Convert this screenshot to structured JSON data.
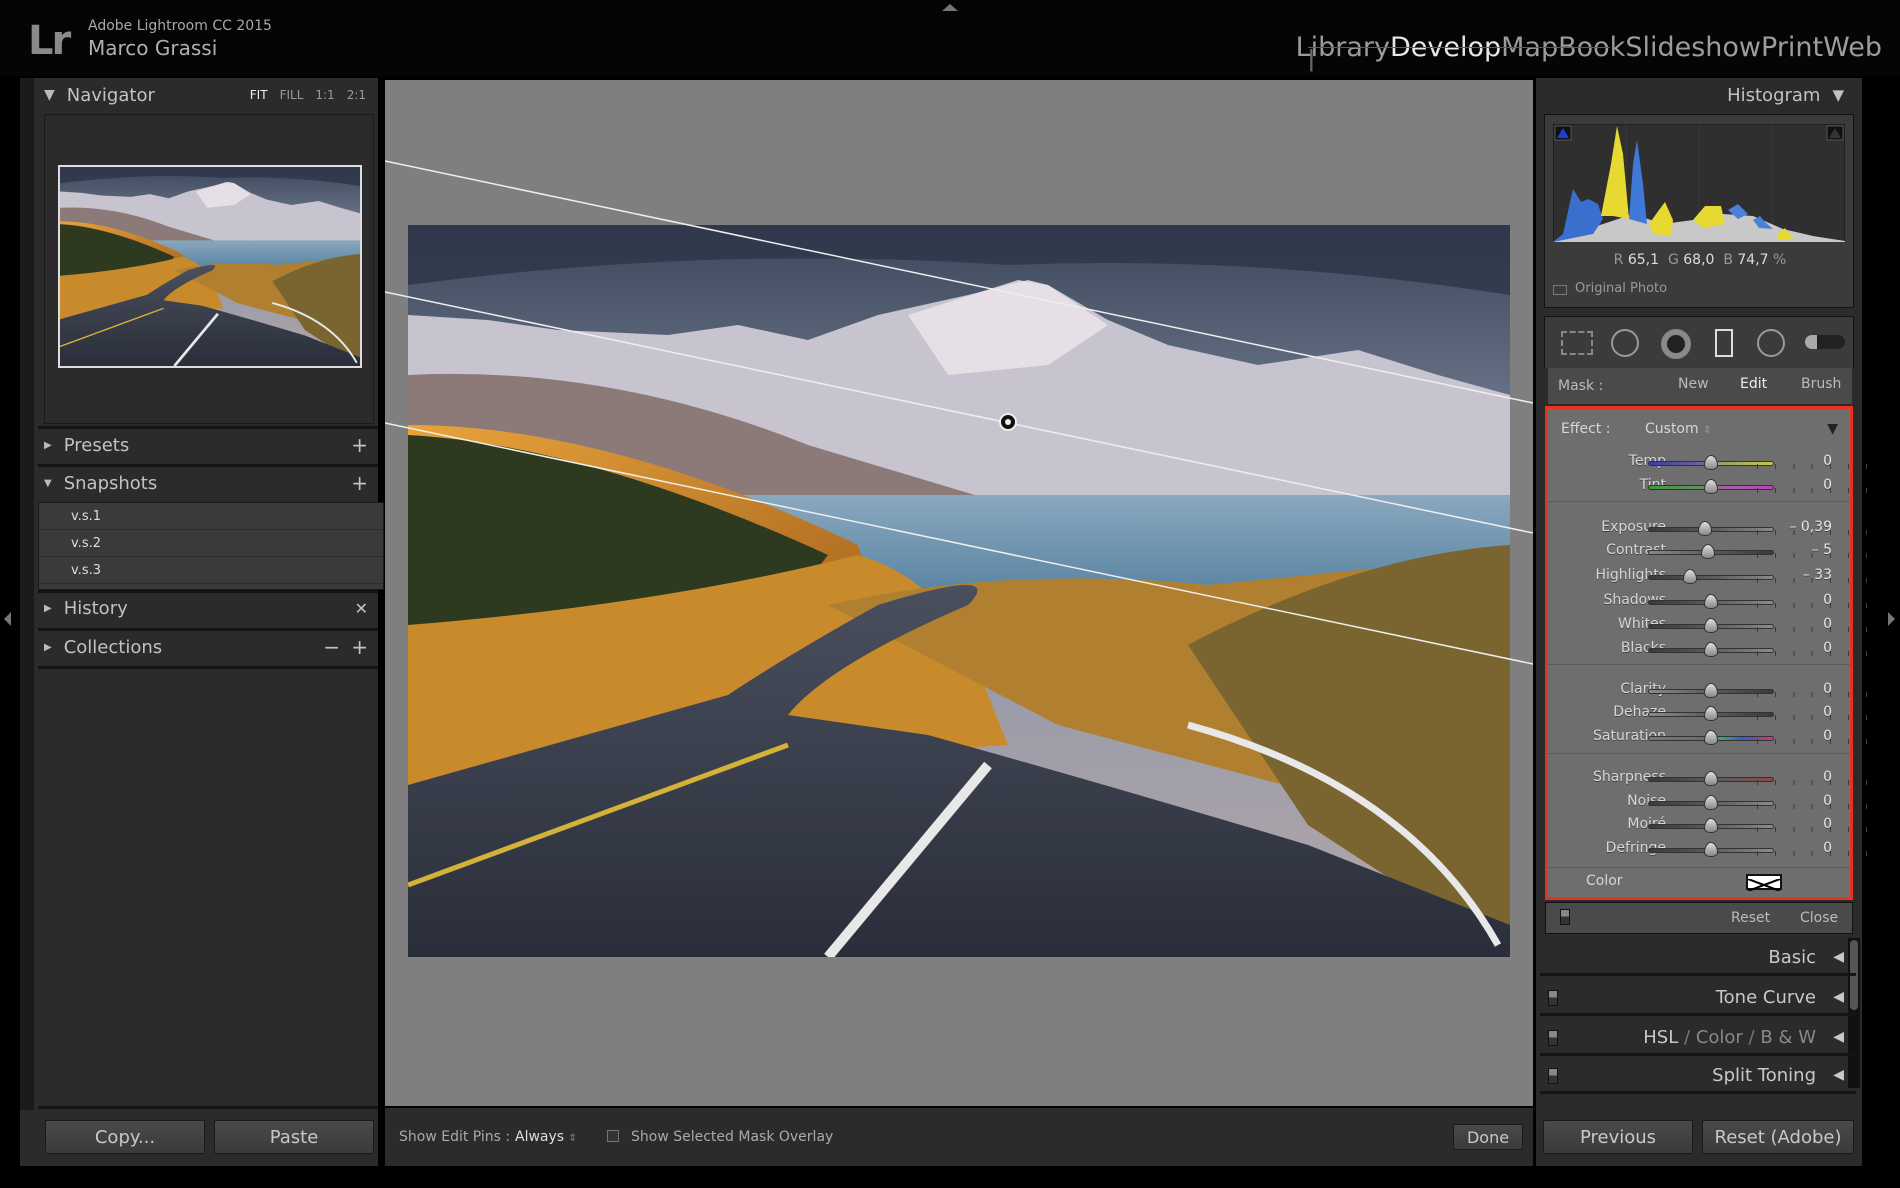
{
  "app": {
    "logo": "Lr",
    "product": "Adobe Lightroom CC 2015",
    "user": "Marco Grassi"
  },
  "modules": [
    {
      "label": "Library",
      "active": false
    },
    {
      "label": "Develop",
      "active": true
    },
    {
      "label": "Map",
      "active": false
    },
    {
      "label": "Book",
      "active": false
    },
    {
      "label": "Slideshow",
      "active": false
    },
    {
      "label": "Print",
      "active": false
    },
    {
      "label": "Web",
      "active": false
    }
  ],
  "left": {
    "navigator": {
      "title": "Navigator",
      "options": [
        "FIT",
        "FILL",
        "1:1",
        "2:1"
      ],
      "selected": "FIT"
    },
    "presets": "Presets",
    "snapshots": "Snapshots",
    "snapshot_items": [
      "v.s.1",
      "v.s.2",
      "v.s.3"
    ],
    "history": "History",
    "collections": "Collections",
    "copy": "Copy...",
    "paste": "Paste"
  },
  "toolbar": {
    "show_pins_label": "Show Edit Pins :",
    "show_pins_value": "Always",
    "overlay_label": "Show Selected Mask Overlay",
    "done": "Done"
  },
  "right": {
    "histogram": {
      "title": "Histogram",
      "r_label": "R",
      "r": "65,1",
      "g_label": "G",
      "g": "68,0",
      "b_label": "B",
      "b": "74,7",
      "pct": "%",
      "original_photo": "Original Photo"
    },
    "mask": {
      "label": "Mask :",
      "new": "New",
      "edit": "Edit",
      "brush": "Brush"
    },
    "effect": {
      "label": "Effect :",
      "value": "Custom"
    },
    "sliders": [
      {
        "label": "Temp",
        "value": "0",
        "num": 0,
        "min": -100,
        "max": 100,
        "track": "temp"
      },
      {
        "label": "Tint",
        "value": "0",
        "num": 0,
        "min": -100,
        "max": 100,
        "track": "tint"
      },
      {
        "label": "Exposure",
        "value": "– 0,39",
        "num": -0.39,
        "min": -4,
        "max": 4,
        "track": "dark"
      },
      {
        "label": "Contrast",
        "value": "– 5",
        "num": -5,
        "min": -100,
        "max": 100,
        "track": "light"
      },
      {
        "label": "Highlights",
        "value": "– 33",
        "num": -33,
        "min": -100,
        "max": 100,
        "track": "dark"
      },
      {
        "label": "Shadows",
        "value": "0",
        "num": 0,
        "min": -100,
        "max": 100,
        "track": "dark"
      },
      {
        "label": "Whites",
        "value": "0",
        "num": 0,
        "min": -100,
        "max": 100,
        "track": "dark"
      },
      {
        "label": "Blacks",
        "value": "0",
        "num": 0,
        "min": -100,
        "max": 100,
        "track": "dark"
      },
      {
        "label": "Clarity",
        "value": "0",
        "num": 0,
        "min": -100,
        "max": 100,
        "track": "light"
      },
      {
        "label": "Dehaze",
        "value": "0",
        "num": 0,
        "min": -100,
        "max": 100,
        "track": "light"
      },
      {
        "label": "Saturation",
        "value": "0",
        "num": 0,
        "min": -100,
        "max": 100,
        "track": "sat"
      },
      {
        "label": "Sharpness",
        "value": "0",
        "num": 0,
        "min": -100,
        "max": 100,
        "track": "sharp"
      },
      {
        "label": "Noise",
        "value": "0",
        "num": 0,
        "min": -100,
        "max": 100,
        "track": "dark"
      },
      {
        "label": "Moiré",
        "value": "0",
        "num": 0,
        "min": -100,
        "max": 100,
        "track": "dark"
      },
      {
        "label": "Defringe",
        "value": "0",
        "num": 0,
        "min": -100,
        "max": 100,
        "track": "dark"
      }
    ],
    "color_label": "Color",
    "reset": "Reset",
    "close": "Close",
    "sections": {
      "basic": "Basic",
      "tone_curve": "Tone Curve",
      "hsl": "HSL",
      "color": "Color",
      "bw": "B & W",
      "split_toning": "Split Toning"
    },
    "previous": "Previous",
    "reset_adobe": "Reset (Adobe)"
  },
  "colors": {
    "highlight_box": "#e8321e",
    "panel": "#2b2b2b",
    "canvas": "#7f7f7f"
  }
}
